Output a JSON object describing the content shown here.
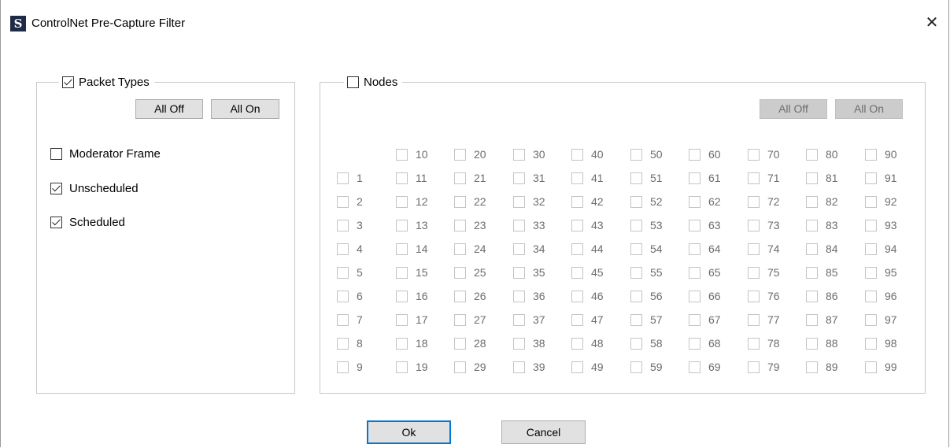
{
  "window": {
    "title": "ControlNet Pre-Capture Filter",
    "icon": "S",
    "close_glyph": "✕"
  },
  "packet_types": {
    "legend": "Packet Types",
    "checked": true,
    "all_off": "All Off",
    "all_on": "All On",
    "options": [
      {
        "label": "Moderator Frame",
        "checked": false
      },
      {
        "label": "Unscheduled",
        "checked": true
      },
      {
        "label": "Scheduled",
        "checked": true
      }
    ]
  },
  "nodes": {
    "legend": "Nodes",
    "checked": false,
    "all_off": "All Off",
    "all_on": "All On",
    "columns": [
      [
        "1",
        "2",
        "3",
        "4",
        "5",
        "6",
        "7",
        "8",
        "9"
      ],
      [
        "10",
        "11",
        "12",
        "13",
        "14",
        "15",
        "16",
        "17",
        "18",
        "19"
      ],
      [
        "20",
        "21",
        "22",
        "23",
        "24",
        "25",
        "26",
        "27",
        "28",
        "29"
      ],
      [
        "30",
        "31",
        "32",
        "33",
        "34",
        "35",
        "36",
        "37",
        "38",
        "39"
      ],
      [
        "40",
        "41",
        "42",
        "43",
        "44",
        "45",
        "46",
        "47",
        "48",
        "49"
      ],
      [
        "50",
        "51",
        "52",
        "53",
        "54",
        "55",
        "56",
        "57",
        "58",
        "59"
      ],
      [
        "60",
        "61",
        "62",
        "63",
        "64",
        "65",
        "66",
        "67",
        "68",
        "69"
      ],
      [
        "70",
        "71",
        "72",
        "73",
        "74",
        "75",
        "76",
        "77",
        "78",
        "79"
      ],
      [
        "80",
        "81",
        "82",
        "83",
        "84",
        "85",
        "86",
        "87",
        "88",
        "89"
      ],
      [
        "90",
        "91",
        "92",
        "93",
        "94",
        "95",
        "96",
        "97",
        "98",
        "99"
      ]
    ]
  },
  "footer": {
    "ok": "Ok",
    "cancel": "Cancel"
  }
}
